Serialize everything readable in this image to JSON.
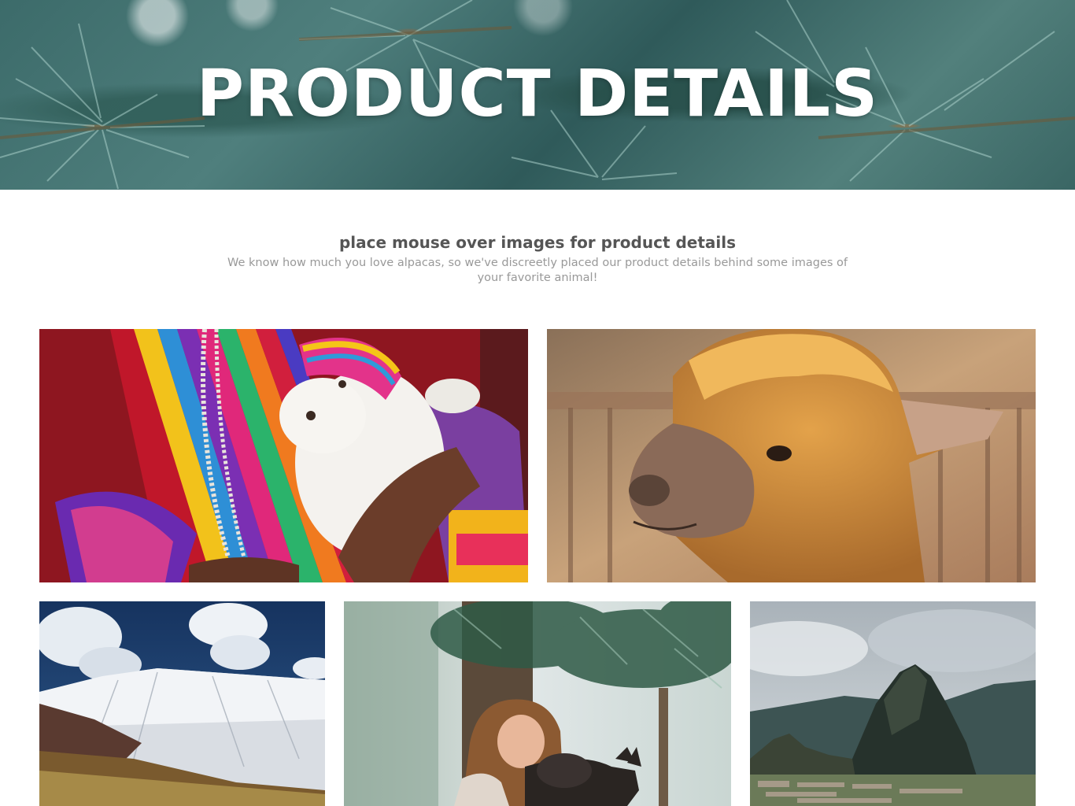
{
  "hero": {
    "title": "PRODUCT DETAILS"
  },
  "intro": {
    "heading": "place mouse over images for product details",
    "text": "We know how much you love alpacas, so we've discreetly placed our product details behind some images of your favorite animal!"
  },
  "gallery": {
    "tiles": [
      {
        "subject": "child in colorful woven clothing holding a baby alpaca"
      },
      {
        "subject": "close-up of a fluffy alpaca with golden fleece"
      },
      {
        "subject": "snow-capped mountains under blue sky with clouds"
      },
      {
        "subject": "woman hugging a dark alpaca under pine trees"
      },
      {
        "subject": "Machu Picchu ruins and mountain peak"
      }
    ]
  },
  "colors": {
    "hero_bg": "#3c6b6a",
    "title_text": "#ffffff",
    "heading_text": "#555555",
    "body_text": "#999999"
  }
}
